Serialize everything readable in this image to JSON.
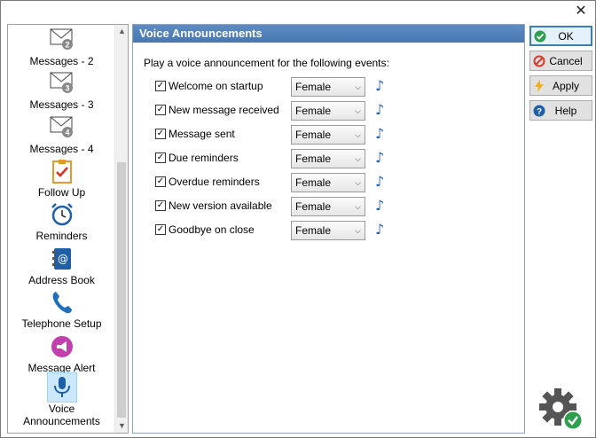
{
  "window": {
    "close_glyph": "✕"
  },
  "sidebar": {
    "items": [
      {
        "label": "Messages - 2",
        "icon": "envelope-badge-2-icon",
        "badge": "2"
      },
      {
        "label": "Messages - 3",
        "icon": "envelope-badge-3-icon",
        "badge": "3"
      },
      {
        "label": "Messages - 4",
        "icon": "envelope-badge-4-icon",
        "badge": "4"
      },
      {
        "label": "Follow Up",
        "icon": "clipboard-check-icon"
      },
      {
        "label": "Reminders",
        "icon": "alarm-clock-icon"
      },
      {
        "label": "Address Book",
        "icon": "address-book-icon"
      },
      {
        "label": "Telephone Setup",
        "icon": "telephone-icon"
      },
      {
        "label": "Message Alert",
        "icon": "megaphone-icon"
      },
      {
        "label": "Voice Announcements",
        "label_line1": "Voice",
        "label_line2": "Announcements",
        "icon": "microphone-icon",
        "selected": true
      }
    ]
  },
  "panel": {
    "title": "Voice Announcements",
    "intro": "Play a voice announcement for the following events:",
    "rows": [
      {
        "label": "Welcome on startup",
        "checked": true,
        "voice": "Female"
      },
      {
        "label": "New message received",
        "checked": true,
        "voice": "Female"
      },
      {
        "label": "Message sent",
        "checked": true,
        "voice": "Female"
      },
      {
        "label": "Due reminders",
        "checked": true,
        "voice": "Female"
      },
      {
        "label": "Overdue reminders",
        "checked": true,
        "voice": "Female"
      },
      {
        "label": "New version available",
        "checked": true,
        "voice": "Female"
      },
      {
        "label": "Goodbye on close",
        "checked": true,
        "voice": "Female"
      }
    ],
    "check_glyph": "✓",
    "note_glyph": "♪"
  },
  "buttons": {
    "ok": "OK",
    "cancel": "Cancel",
    "apply": "Apply",
    "help": "Help"
  },
  "colors": {
    "header": "#4f81bd",
    "ok_icon": "#2e9e4f",
    "cancel_icon": "#d93a2a",
    "apply_icon": "#f2b01e",
    "help_icon": "#1f5fa8"
  }
}
